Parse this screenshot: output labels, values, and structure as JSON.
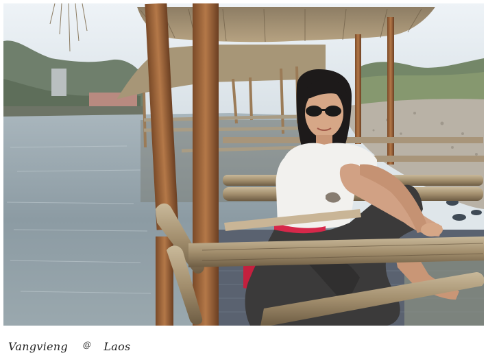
{
  "caption": {
    "place": "Vangvieng",
    "separator": "@",
    "country": "Laos"
  }
}
